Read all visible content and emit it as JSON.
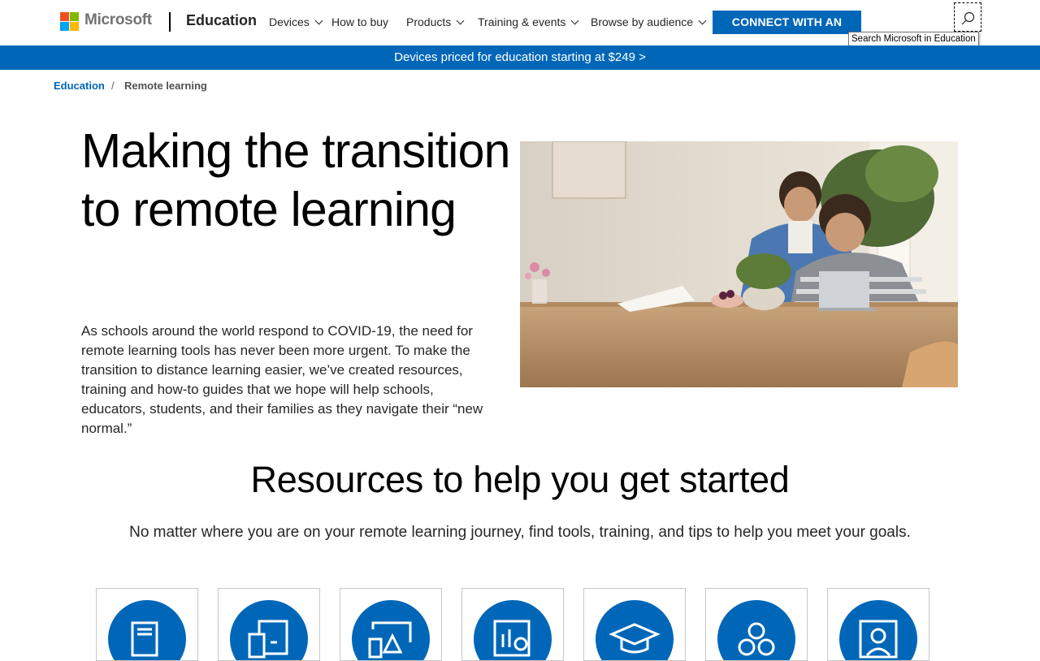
{
  "header": {
    "brand": "Microsoft",
    "section": "Education",
    "nav": [
      {
        "label": "Devices",
        "has_dropdown": true
      },
      {
        "label": "How to buy",
        "has_dropdown": false
      },
      {
        "label": "Products",
        "has_dropdown": true
      },
      {
        "label": "Training & events",
        "has_dropdown": true
      },
      {
        "label": "Browse by audience",
        "has_dropdown": true
      }
    ],
    "cta": "CONNECT WITH AN EXPERT",
    "search_tooltip": "Search Microsoft in Education"
  },
  "promo": {
    "text": "Devices priced for education starting at $249 >"
  },
  "breadcrumb": {
    "home": "Education",
    "separator": "/",
    "current": "Remote learning"
  },
  "hero": {
    "title": "Making the transition to remote learning",
    "body": "As schools around the world respond to COVID-19, the need for remote learning tools has never been more urgent. To make the transition to distance learning easier, we’ve created resources, training and how-to guides that we hope will help schools, educators, students, and their families as they navigate their “new normal.”"
  },
  "resources": {
    "title": "Resources to help you get started",
    "subtitle": "No matter where you are on your remote learning journey, find tools, training, and tips to help you meet your goals.",
    "cards": [
      {
        "icon": "book-pencil-icon"
      },
      {
        "icon": "devices-icon"
      },
      {
        "icon": "classroom-board-icon"
      },
      {
        "icon": "analytics-icon"
      },
      {
        "icon": "graduation-cap-icon"
      },
      {
        "icon": "community-icon"
      },
      {
        "icon": "person-portrait-icon"
      }
    ]
  },
  "colors": {
    "accent": "#0067b8",
    "ms_red": "#f25022",
    "ms_green": "#7fba00",
    "ms_blue": "#00a4ef",
    "ms_yellow": "#ffb900"
  }
}
